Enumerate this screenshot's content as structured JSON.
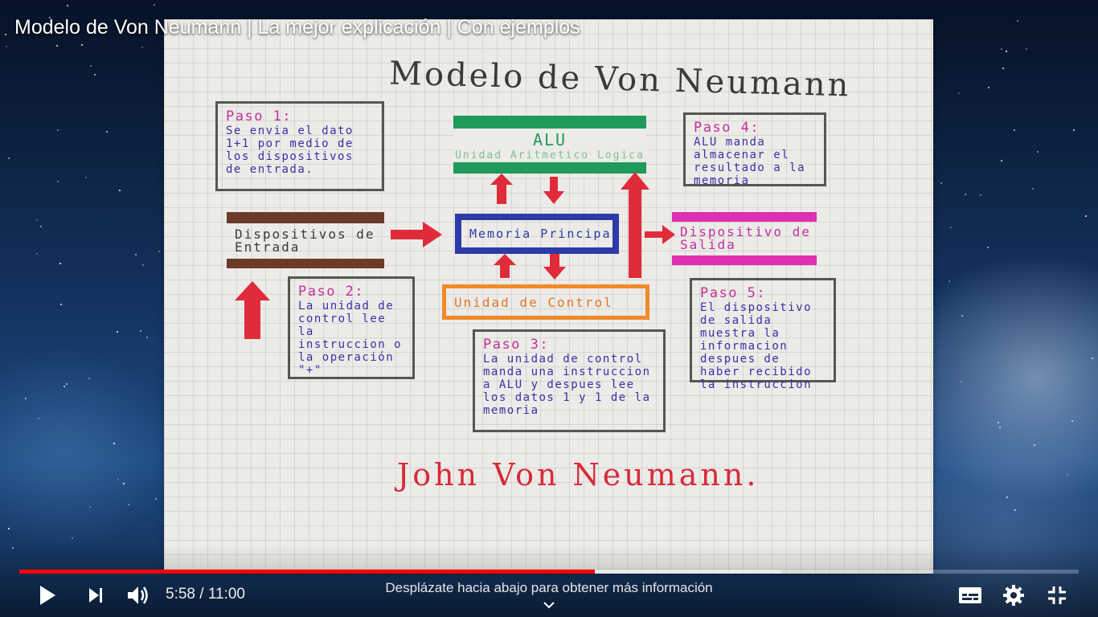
{
  "video": {
    "title": "Modelo de Von Neumann | La mejor explicación | Con ejemplos"
  },
  "slide": {
    "heading": "Modelo de Von Neumann",
    "alu": {
      "title": "ALU",
      "subtitle": "Unidad Aritmetico Logica"
    },
    "memory": "Memoria Principal",
    "input_device": "Dispositivos de Entrada",
    "output_device": "Dispositivo de Salida",
    "control_unit": "Unidad de Control",
    "steps": [
      {
        "head": "Paso 1:",
        "text": "Se envia el dato 1+1 por medio de los dispositivos de entrada."
      },
      {
        "head": "Paso 2:",
        "text": "La unidad de control lee la instruccion o la operación \"+\""
      },
      {
        "head": "Paso 3:",
        "text": "La unidad de control manda una instruccion a ALU y despues lee los datos 1 y 1 de la memoria"
      },
      {
        "head": "Paso 4:",
        "text": "ALU manda almacenar el resultado a la memoria"
      },
      {
        "head": "Paso 5:",
        "text": "El dispositivo de salida muestra la informacion despues de haber recibido la instruccion"
      }
    ],
    "author": "John Von Neumann."
  },
  "player": {
    "current_time": "5:58",
    "separator": "/",
    "duration": "11:00",
    "played_fraction": 0.543,
    "buffered_fraction": 0.719,
    "hint": "Desplázate hacia abajo para obtener más información",
    "icons": {
      "play": "play-icon",
      "next": "next-icon",
      "volume": "volume-icon",
      "subtitles": "subtitles-icon",
      "settings": "gear-icon",
      "exit_fullscreen": "exit-fullscreen-icon",
      "chevron": "chevron-down-icon"
    },
    "colors": {
      "progress": "#ff0000",
      "text": "#ffffff"
    }
  }
}
